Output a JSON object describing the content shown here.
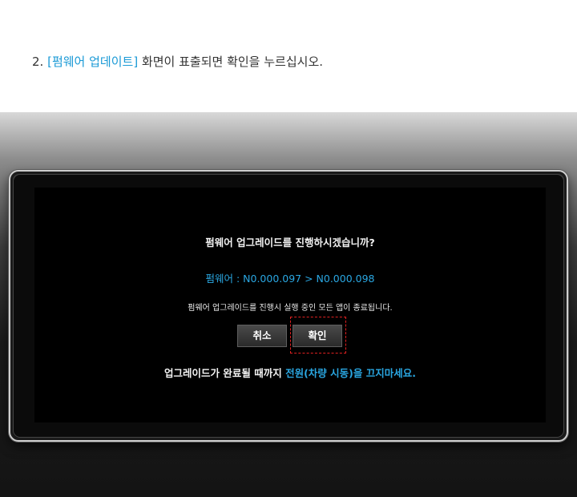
{
  "instruction": {
    "step": "2.",
    "highlight": "[펌웨어 업데이트]",
    "text": " 화면이 표출되면 확인을 누르십시오."
  },
  "dialog": {
    "question": "펌웨어 업그레이드를 진행하시겠습니까?",
    "version": "펌웨어 : N0.000.097 > N0.000.098",
    "warning": "펌웨어 업그레이드를 진행시 실행 중인 모든 앱이 종료됩니다.",
    "cancel_label": "취소",
    "confirm_label": "확인",
    "footer_text": "업그레이드가 완료될 때까지 ",
    "footer_highlight": "전원(차량 시동)을 끄지마세요."
  },
  "colors": {
    "accent": "#1a9ad6",
    "screen_accent": "#2aa7e2",
    "highlight_box": "#e02020"
  }
}
